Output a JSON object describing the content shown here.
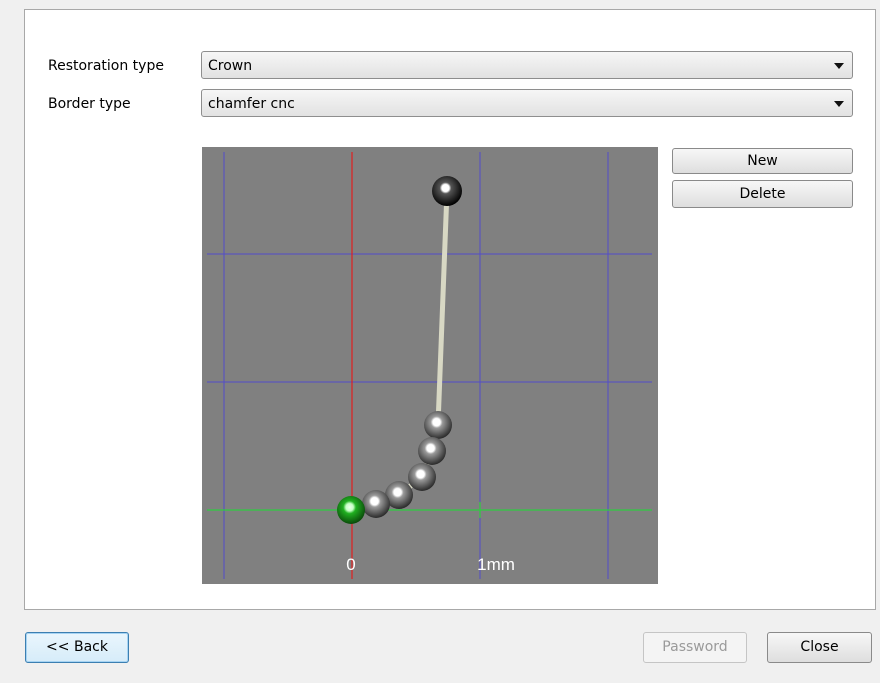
{
  "form": {
    "restoration_type": {
      "label": "Restoration type",
      "value": "Crown"
    },
    "border_type": {
      "label": "Border type",
      "value": "chamfer cnc"
    }
  },
  "profile_editor": {
    "axis_labels": {
      "origin": "0",
      "scale": "1mm"
    },
    "colors": {
      "background": "#808080",
      "grid": "#4a44d8",
      "x_axis": "#2ecc40",
      "y_axis": "#e02020",
      "curve": "#d8d8c4",
      "origin_point": "#1faa1f",
      "control_point": "#555555",
      "end_point": "#111111"
    }
  },
  "side_buttons": {
    "new": "New",
    "delete": "Delete"
  },
  "footer": {
    "back": "<< Back",
    "password": "Password",
    "close": "Close"
  }
}
